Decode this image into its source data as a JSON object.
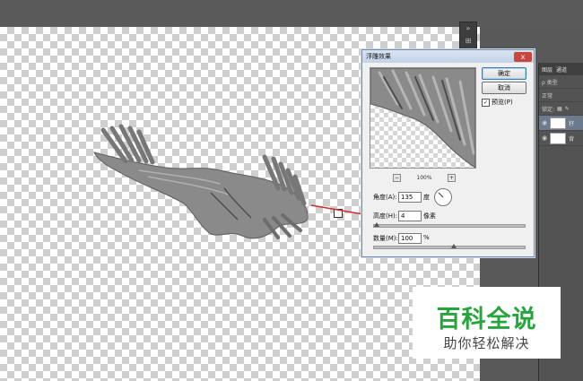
{
  "dialog": {
    "title": "浮雕效果",
    "ok_label": "确定",
    "cancel_label": "取消",
    "preview_label": "预览(P)",
    "preview_checked": true,
    "zoom_value": "100%",
    "zoom_minus": "−",
    "zoom_plus": "+",
    "angle_label": "角度(A):",
    "angle_value": "135",
    "angle_unit": "度",
    "height_label": "高度(H):",
    "height_value": "4",
    "height_unit": "像素",
    "amount_label": "数量(M):",
    "amount_value": "100",
    "amount_unit": "%",
    "close_symbol": "x"
  },
  "layers_panel": {
    "tabs": [
      "图层",
      "通道"
    ],
    "filter_label": "ρ 类型",
    "blend_mode": "正常",
    "lock_label": "锁定:",
    "layers": [
      {
        "name": "籽",
        "active": true
      },
      {
        "name": "背",
        "active": false
      }
    ]
  },
  "watermark": {
    "line1": "百科全说",
    "line2": "助你轻松解决"
  },
  "colors": {
    "accent_green": "#27a53d",
    "arrow_red": "#d42a2a"
  }
}
